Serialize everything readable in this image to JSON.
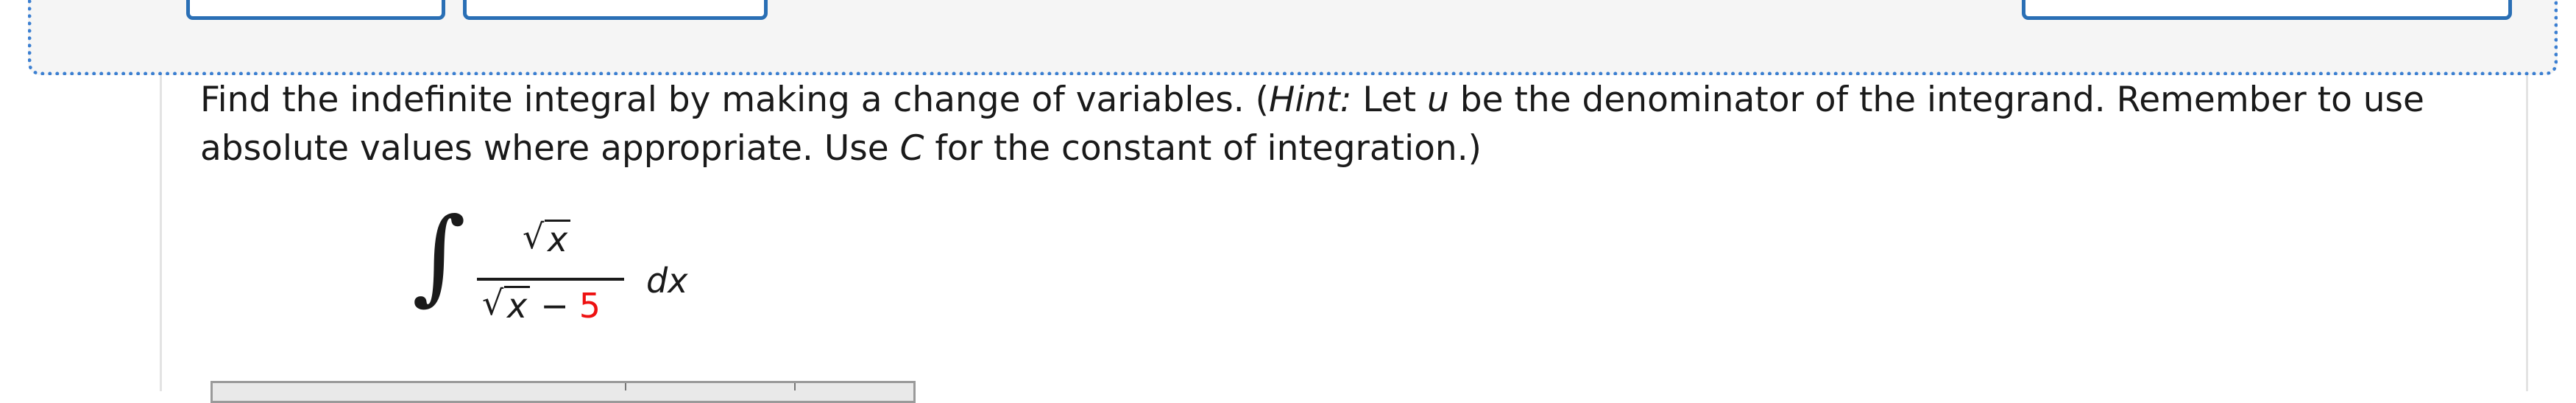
{
  "toolbar": {
    "buttons": [
      "",
      "",
      ""
    ]
  },
  "question": {
    "line1_pre": "Find the indefinite integral by making a change of variables. (",
    "hint_label": "Hint:",
    "line1_mid": " Let ",
    "var_u": "u",
    "line1_post": " be the denominator of the integrand. Remember to use absolute values where appropriate. Use ",
    "var_C": "C",
    "line2_post": " for the constant of integration.)"
  },
  "expression": {
    "integral_sign": "∫",
    "numerator_var": "x",
    "denominator_var": "x",
    "minus": "−",
    "constant": "5",
    "differential": "dx",
    "radical": "√"
  }
}
